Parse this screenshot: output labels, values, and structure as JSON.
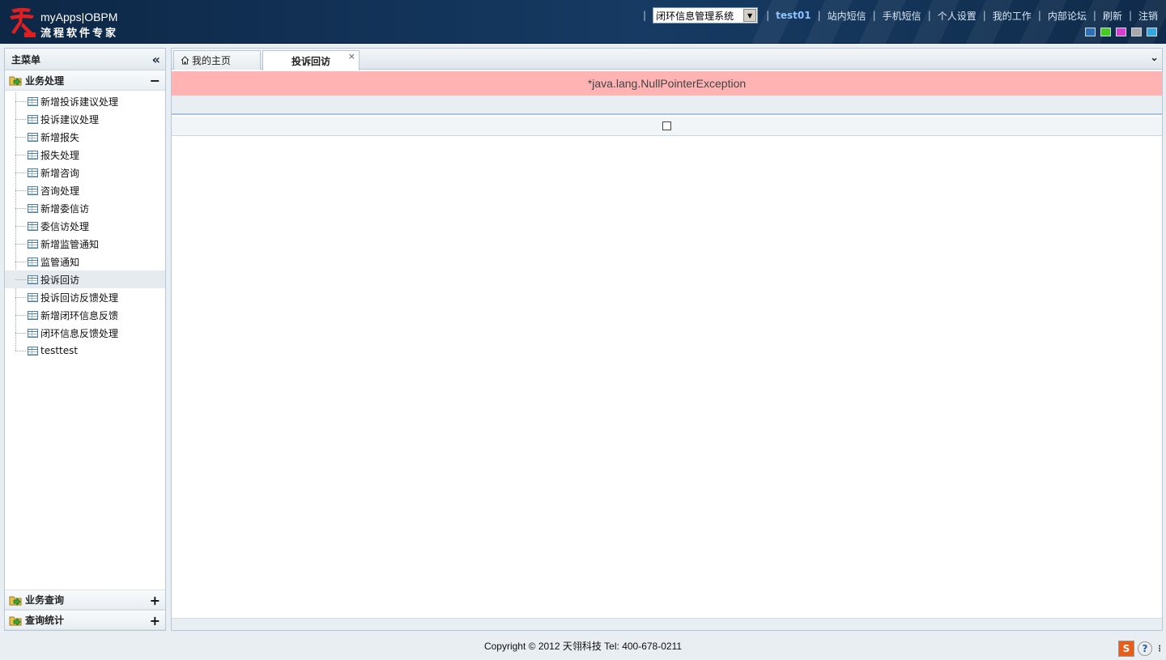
{
  "brand": {
    "line1": "myApps|OBPM",
    "line2": "流程软件专家"
  },
  "topnav": {
    "system_select": "闭环信息管理系统",
    "user": "test01",
    "links": [
      "站内短信",
      "手机短信",
      "个人设置",
      "我的工作",
      "内部论坛",
      "刷新",
      "注销"
    ]
  },
  "themes": {
    "colors": [
      "#2a6fb8",
      "#44cc22",
      "#d63ed0",
      "#aaaaaa",
      "#33a8e0"
    ]
  },
  "sidebar": {
    "title": "主菜单",
    "groups": [
      {
        "label": "业务处理",
        "expanded": true,
        "items": [
          "新增投诉建议处理",
          "投诉建议处理",
          "新增报失",
          "报失处理",
          "新增咨询",
          "咨询处理",
          "新增委信访",
          "委信访处理",
          "新增监管通知",
          "监管通知",
          "投诉回访",
          "投诉回访反馈处理",
          "新增闭环信息反馈",
          "闭环信息反馈处理",
          "testtest"
        ],
        "active_index": 10
      },
      {
        "label": "业务查询",
        "expanded": false
      },
      {
        "label": "查询统计",
        "expanded": false
      }
    ]
  },
  "tabs": {
    "home_label": "我的主页",
    "current_label": "投诉回访",
    "close_glyph": "×"
  },
  "content": {
    "error_message": "*java.lang.NullPointerException"
  },
  "footer": {
    "copyright": "Copyright © 2012 天翎科技 Tel: 400-678-0211"
  }
}
